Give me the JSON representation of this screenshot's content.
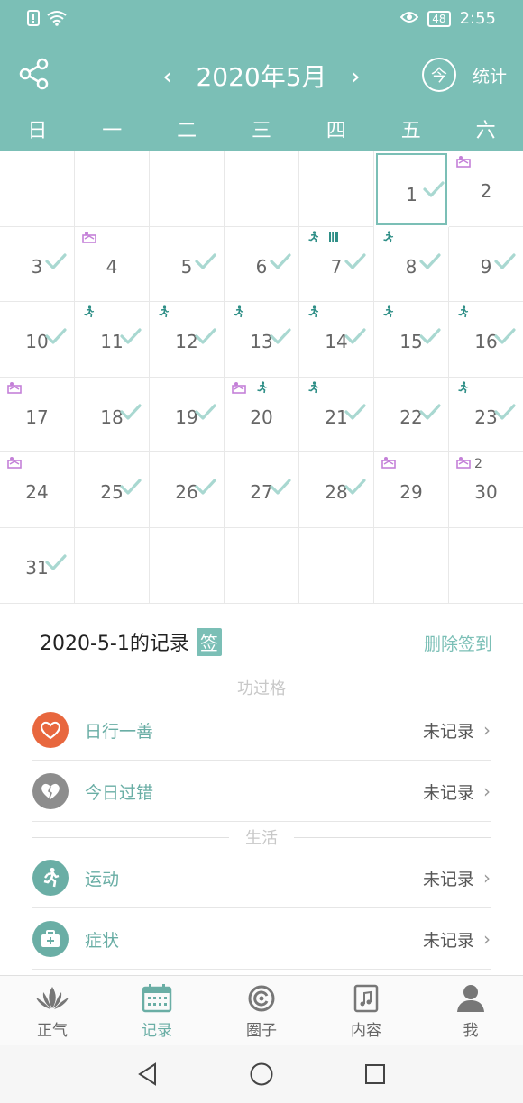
{
  "status_bar": {
    "battery": "48",
    "time": "2:55"
  },
  "header": {
    "prev_label": "‹",
    "month_title": "2020年5月",
    "next_label": "›",
    "stats_icon_text": "今",
    "stats_label": "统计"
  },
  "weekdays": [
    "日",
    "一",
    "二",
    "三",
    "四",
    "五",
    "六"
  ],
  "calendar": {
    "selected_day": "1",
    "cells": [
      {
        "day": "",
        "check": false,
        "mood": false,
        "run": false,
        "book": false
      },
      {
        "day": "",
        "check": false,
        "mood": false,
        "run": false,
        "book": false
      },
      {
        "day": "",
        "check": false,
        "mood": false,
        "run": false,
        "book": false
      },
      {
        "day": "",
        "check": false,
        "mood": false,
        "run": false,
        "book": false
      },
      {
        "day": "",
        "check": false,
        "mood": false,
        "run": false,
        "book": false
      },
      {
        "day": "1",
        "check": true,
        "mood": false,
        "run": false,
        "book": false
      },
      {
        "day": "2",
        "check": false,
        "mood": true,
        "run": false,
        "book": false
      },
      {
        "day": "3",
        "check": true,
        "mood": false,
        "run": false,
        "book": false
      },
      {
        "day": "4",
        "check": false,
        "mood": true,
        "run": false,
        "book": false
      },
      {
        "day": "5",
        "check": true,
        "mood": false,
        "run": false,
        "book": false
      },
      {
        "day": "6",
        "check": true,
        "mood": false,
        "run": false,
        "book": false
      },
      {
        "day": "7",
        "check": true,
        "mood": false,
        "run": true,
        "book": true
      },
      {
        "day": "8",
        "check": true,
        "mood": false,
        "run": true,
        "book": false
      },
      {
        "day": "9",
        "check": true,
        "mood": false,
        "run": false,
        "book": false
      },
      {
        "day": "10",
        "check": true,
        "mood": false,
        "run": false,
        "book": false
      },
      {
        "day": "11",
        "check": true,
        "mood": false,
        "run": true,
        "book": false
      },
      {
        "day": "12",
        "check": true,
        "mood": false,
        "run": true,
        "book": false
      },
      {
        "day": "13",
        "check": true,
        "mood": false,
        "run": true,
        "book": false
      },
      {
        "day": "14",
        "check": true,
        "mood": false,
        "run": true,
        "book": false
      },
      {
        "day": "15",
        "check": true,
        "mood": false,
        "run": true,
        "book": false
      },
      {
        "day": "16",
        "check": true,
        "mood": false,
        "run": true,
        "book": false
      },
      {
        "day": "17",
        "check": false,
        "mood": true,
        "run": false,
        "book": false
      },
      {
        "day": "18",
        "check": true,
        "mood": false,
        "run": false,
        "book": false
      },
      {
        "day": "19",
        "check": true,
        "mood": false,
        "run": false,
        "book": false
      },
      {
        "day": "20",
        "check": false,
        "mood": true,
        "run": true,
        "book": false
      },
      {
        "day": "21",
        "check": true,
        "mood": false,
        "run": true,
        "book": false
      },
      {
        "day": "22",
        "check": true,
        "mood": false,
        "run": false,
        "book": false
      },
      {
        "day": "23",
        "check": true,
        "mood": false,
        "run": true,
        "book": false
      },
      {
        "day": "24",
        "check": false,
        "mood": true,
        "run": false,
        "book": false
      },
      {
        "day": "25",
        "check": true,
        "mood": false,
        "run": false,
        "book": false
      },
      {
        "day": "26",
        "check": true,
        "mood": false,
        "run": false,
        "book": false
      },
      {
        "day": "27",
        "check": true,
        "mood": false,
        "run": false,
        "book": false
      },
      {
        "day": "28",
        "check": true,
        "mood": false,
        "run": false,
        "book": false
      },
      {
        "day": "29",
        "check": false,
        "mood": true,
        "run": false,
        "book": false
      },
      {
        "day": "30",
        "check": false,
        "mood": true,
        "run": false,
        "book": false,
        "count": "2"
      },
      {
        "day": "31",
        "check": true,
        "mood": false,
        "run": false,
        "book": false
      },
      {
        "day": "",
        "check": false,
        "mood": false,
        "run": false,
        "book": false
      },
      {
        "day": "",
        "check": false,
        "mood": false,
        "run": false,
        "book": false
      },
      {
        "day": "",
        "check": false,
        "mood": false,
        "run": false,
        "book": false
      },
      {
        "day": "",
        "check": false,
        "mood": false,
        "run": false,
        "book": false
      },
      {
        "day": "",
        "check": false,
        "mood": false,
        "run": false,
        "book": false
      },
      {
        "day": "",
        "check": false,
        "mood": false,
        "run": false,
        "book": false
      }
    ]
  },
  "record": {
    "title": "2020-5-1的记录",
    "tag": "签",
    "delete_label": "删除签到",
    "section_merit": "功过格",
    "section_life": "生活",
    "rows": [
      {
        "label": "日行一善",
        "value": "未记录",
        "icon": "heart-icon",
        "color": "#e8673e"
      },
      {
        "label": "今日过错",
        "value": "未记录",
        "icon": "broken-heart-icon",
        "color": "#8d8d8d"
      },
      {
        "label": "运动",
        "value": "未记录",
        "icon": "run-icon",
        "color": "#6aaea5"
      },
      {
        "label": "症状",
        "value": "未记录",
        "icon": "medkit-icon",
        "color": "#6aaea5"
      }
    ]
  },
  "bottom_nav": [
    {
      "label": "正气",
      "icon": "lotus-icon",
      "active": false
    },
    {
      "label": "记录",
      "icon": "calendar-icon",
      "active": true
    },
    {
      "label": "圈子",
      "icon": "circle-icon",
      "active": false
    },
    {
      "label": "内容",
      "icon": "music-doc-icon",
      "active": false
    },
    {
      "label": "我",
      "icon": "user-icon",
      "active": false
    }
  ],
  "colors": {
    "teal": "#7bbfb6",
    "mood": "#c480d8",
    "run": "#2f8f87"
  }
}
